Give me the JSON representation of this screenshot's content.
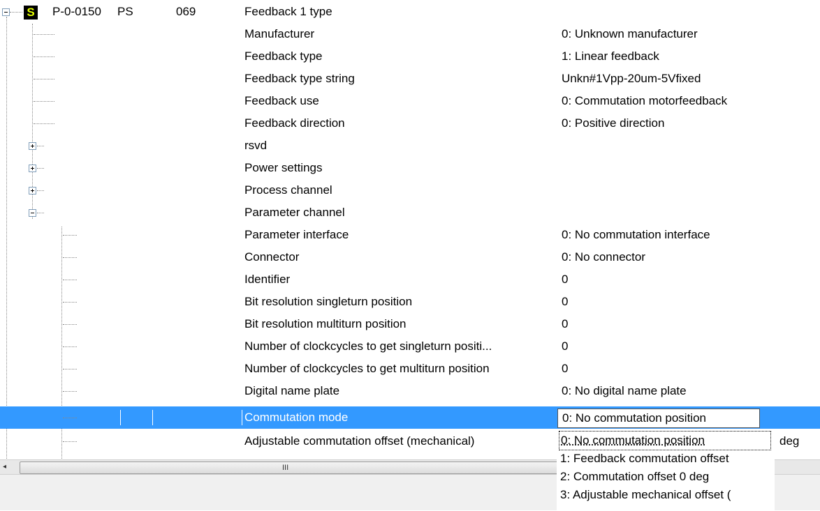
{
  "header": {
    "code": "P-0-0150",
    "type": "PS",
    "number": "069",
    "name": "Feedback 1 type",
    "icon_letter": "S"
  },
  "rows": [
    {
      "name": "Manufacturer",
      "value": "0: Unknown manufacturer"
    },
    {
      "name": "Feedback type",
      "value": "1: Linear feedback"
    },
    {
      "name": "Feedback type string",
      "value": "Unkn#1Vpp-20um-5Vfixed"
    },
    {
      "name": "Feedback use",
      "value": "0: Commutation motorfeedback"
    },
    {
      "name": "Feedback direction",
      "value": "0: Positive direction"
    },
    {
      "name": "rsvd"
    },
    {
      "name": "Power settings"
    },
    {
      "name": "Process channel"
    },
    {
      "name": "Parameter channel"
    },
    {
      "name": "Parameter interface",
      "value": "0: No commutation interface"
    },
    {
      "name": "Connector",
      "value": "0: No connector"
    },
    {
      "name": "Identifier",
      "value": "0"
    },
    {
      "name": "Bit resolution singleturn position",
      "value": "0"
    },
    {
      "name": "Bit resolution multiturn position",
      "value": "0"
    },
    {
      "name": "Number of clockcycles to get singleturn positi...",
      "value": "0"
    },
    {
      "name": "Number of clockcycles to get multiturn position",
      "value": "0"
    },
    {
      "name": "Digital name plate",
      "value": "0: No digital name plate"
    },
    {
      "name": "Commutation mode",
      "value": "0: No commutation position"
    },
    {
      "name": "Adjustable commutation offset (mechanical)",
      "unit": "deg"
    }
  ],
  "dropdown": {
    "options": [
      "0: No commutation position",
      "1: Feedback commutation offset",
      "2: Commutation offset 0 deg",
      "3: Adjustable mechanical offset ("
    ],
    "selected_index": 0
  },
  "scrollbar": {
    "grip": "III"
  },
  "colors": {
    "selection": "#3399ff",
    "icon_bg": "#000000",
    "icon_fg": "#e4ff00"
  }
}
